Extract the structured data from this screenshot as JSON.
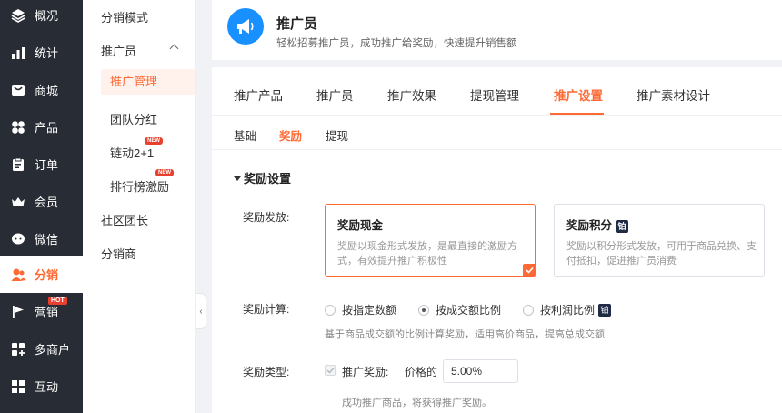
{
  "nav": [
    {
      "label": "概况",
      "icon": "layers-icon"
    },
    {
      "label": "统计",
      "icon": "chart-icon"
    },
    {
      "label": "商城",
      "icon": "shop-icon"
    },
    {
      "label": "产品",
      "icon": "grid-icon"
    },
    {
      "label": "订单",
      "icon": "clipboard-icon"
    },
    {
      "label": "会员",
      "icon": "crown-icon"
    },
    {
      "label": "微信",
      "icon": "chat-icon"
    },
    {
      "label": "分销",
      "icon": "users-icon",
      "active": true
    },
    {
      "label": "营销",
      "icon": "flag-icon",
      "badge": "HOT"
    },
    {
      "label": "多商户",
      "icon": "store-icon"
    },
    {
      "label": "互动",
      "icon": "puzzle-icon"
    }
  ],
  "submenu": {
    "mode": "分销模式",
    "promoter": "推广员",
    "children": [
      "推广管理",
      "团队分红",
      "链动2+1",
      "排行榜激励"
    ],
    "new_badge": "NEW",
    "community": "社区团长",
    "distributor": "分销商"
  },
  "header": {
    "title": "推广员",
    "subtitle": "轻松招募推广员，成功推广给奖励，快速提升销售额"
  },
  "tabs": [
    "推广产品",
    "推广员",
    "推广效果",
    "提现管理",
    "推广设置",
    "推广素材设计"
  ],
  "subtabs": [
    "基础",
    "奖励",
    "提现"
  ],
  "section_title": "奖励设置",
  "reward_issue": {
    "label": "奖励发放:",
    "cash": {
      "title": "奖励现金",
      "desc": "奖励以现金形式发放，是最直接的激励方式，有效提升推广积极性"
    },
    "points": {
      "title": "奖励积分",
      "badge": "铂",
      "desc": "奖励以积分形式发放，可用于商品兑换、支付抵扣，促进推广员消费"
    }
  },
  "reward_calc": {
    "label": "奖励计算:",
    "options": [
      "按指定数额",
      "按成交额比例",
      "按利润比例"
    ],
    "selected": 1,
    "badge": "铂",
    "hint": "基于商品成交额的比例计算奖励，适用高价商品，提高总成交额"
  },
  "reward_type": {
    "label": "奖励类型:",
    "checkbox_label": "推广奖励:",
    "price_label": "价格的",
    "value": "5.00%",
    "hint": "成功推广商品，将获得推广奖励。"
  },
  "colors": {
    "accent": "#ff6a34",
    "sidebar": "#282c34",
    "logo": "#1890ff"
  }
}
